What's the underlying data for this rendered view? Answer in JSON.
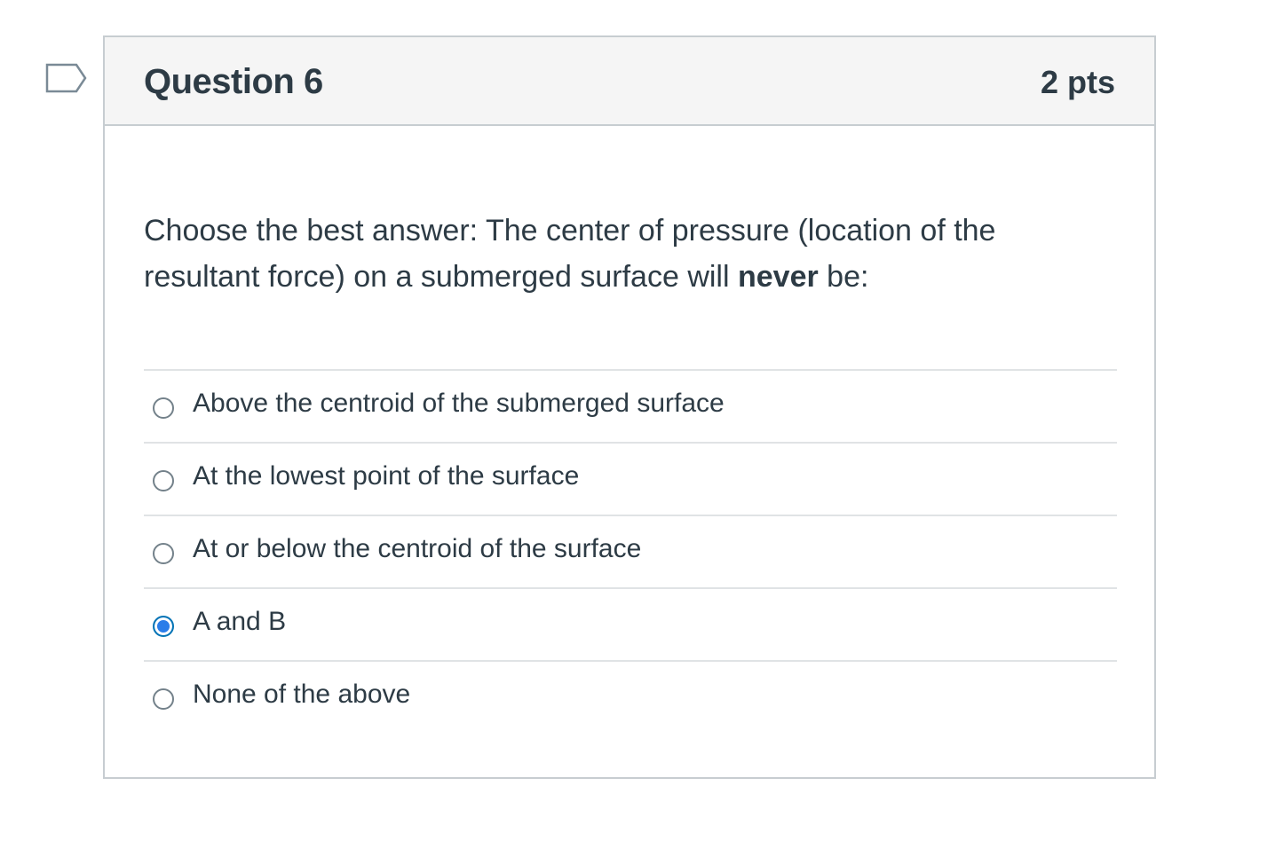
{
  "question": {
    "title": "Question 6",
    "points": "2 pts",
    "text_before": "Choose the best answer: The center of pressure (location of the resultant force) on a submerged surface will ",
    "text_bold": "never",
    "text_after": " be:",
    "flag_icon": "bookmark-flag-icon"
  },
  "answers": [
    {
      "label": "Above the centroid of the submerged surface",
      "selected": false
    },
    {
      "label": "At the lowest point of the surface",
      "selected": false
    },
    {
      "label": "At or below the centroid of the surface",
      "selected": false
    },
    {
      "label": "A and B",
      "selected": true
    },
    {
      "label": "None of the above",
      "selected": false
    }
  ],
  "colors": {
    "accent": "#2b7de9",
    "text": "#2d3b45",
    "border": "#c7cdd1",
    "header_bg": "#f5f5f5"
  }
}
